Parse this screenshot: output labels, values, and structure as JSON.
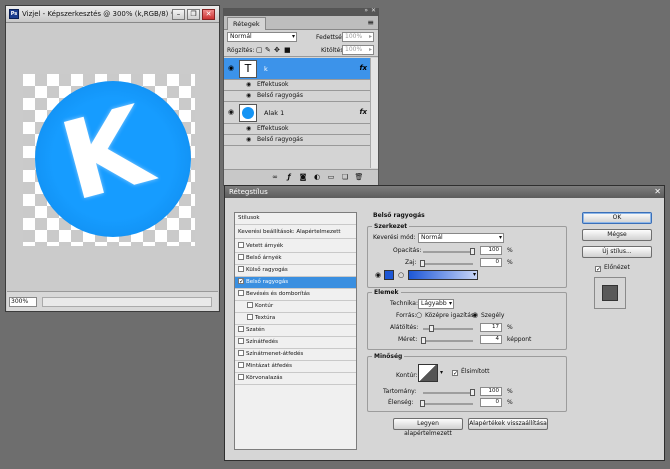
{
  "document": {
    "title": "Vizjel - Képszerkesztés @ 300% (k,RGB/8) *",
    "app_icon": "Ps",
    "zoom": "300%",
    "canvas_letter": "K"
  },
  "window_controls": {
    "minimize": "–",
    "restore": "❐",
    "close": "✕"
  },
  "layers_panel": {
    "tab_label": "Rétegek",
    "blend_mode": "Normál",
    "opacity_label": "Fedettség:",
    "opacity_value": "100%",
    "lock_label": "Rögzítés:",
    "fill_label": "Kitöltés:",
    "fill_value": "100%",
    "layers": [
      {
        "name": "k",
        "thumb": "T",
        "effects_label": "Effektusok",
        "effect": "Belső ragyogás",
        "fx": "fx"
      },
      {
        "name": "Alak 1",
        "effects_label": "Effektusok",
        "effect": "Belső ragyogás",
        "fx": "fx"
      }
    ]
  },
  "dialog": {
    "title": "Rétegstílus",
    "style_list": [
      {
        "label": "Stílusok",
        "checkbox": false
      },
      {
        "label": "Keverési beállítások: Alapértelmezett",
        "checkbox": false
      },
      {
        "label": "Vetett árnyék",
        "checkbox": true,
        "checked": false
      },
      {
        "label": "Belső árnyék",
        "checkbox": true,
        "checked": false
      },
      {
        "label": "Külső ragyogás",
        "checkbox": true,
        "checked": false
      },
      {
        "label": "Belső ragyogás",
        "checkbox": true,
        "checked": true,
        "selected": true
      },
      {
        "label": "Bevésés és domborítás",
        "checkbox": true,
        "checked": false
      },
      {
        "label": "Kontúr",
        "checkbox": true,
        "checked": false,
        "indent": true
      },
      {
        "label": "Textúra",
        "checkbox": true,
        "checked": false,
        "indent": true
      },
      {
        "label": "Szatén",
        "checkbox": true,
        "checked": false
      },
      {
        "label": "Színátfedés",
        "checkbox": true,
        "checked": false
      },
      {
        "label": "Színátmenet-átfedés",
        "checkbox": true,
        "checked": false
      },
      {
        "label": "Mintázat átfedés",
        "checkbox": true,
        "checked": false
      },
      {
        "label": "Körvonalazás",
        "checkbox": true,
        "checked": false
      }
    ],
    "inner_glow": {
      "heading": "Belső ragyogás",
      "structure": {
        "title": "Szerkezet",
        "blend_mode_label": "Keverési mód:",
        "blend_mode_value": "Normál",
        "opacity_label": "Opacitás:",
        "opacity_value": "100",
        "opacity_fraction": 1.0,
        "noise_label": "Zaj:",
        "noise_value": "0",
        "noise_fraction": 0.0,
        "percent": "%",
        "color": "#1d57d6"
      },
      "elements": {
        "title": "Elemek",
        "technique_label": "Technika:",
        "technique_value": "Lágyabb",
        "source_label": "Forrás:",
        "source_center": "Középre igazítás",
        "source_edge": "Szegély",
        "choke_label": "Alátöltés:",
        "choke_value": "17",
        "choke_fraction": 0.17,
        "size_label": "Méret:",
        "size_value": "4",
        "size_unit": "képpont",
        "size_fraction": 0.02,
        "percent": "%"
      },
      "quality": {
        "title": "Minőség",
        "contour_label": "Kontúr:",
        "antialias_label": "Élsimított",
        "range_label": "Tartomány:",
        "range_value": "100",
        "range_fraction": 1.0,
        "jitter_label": "Élenség:",
        "jitter_value": "0",
        "jitter_fraction": 0.0,
        "percent": "%"
      },
      "make_default": "Legyen alapértelmezett",
      "reset_default": "Alapértékek visszaállítása"
    },
    "buttons": {
      "ok": "OK",
      "cancel": "Mégse",
      "new_style": "Új stílus...",
      "preview": "Előnézet"
    }
  }
}
